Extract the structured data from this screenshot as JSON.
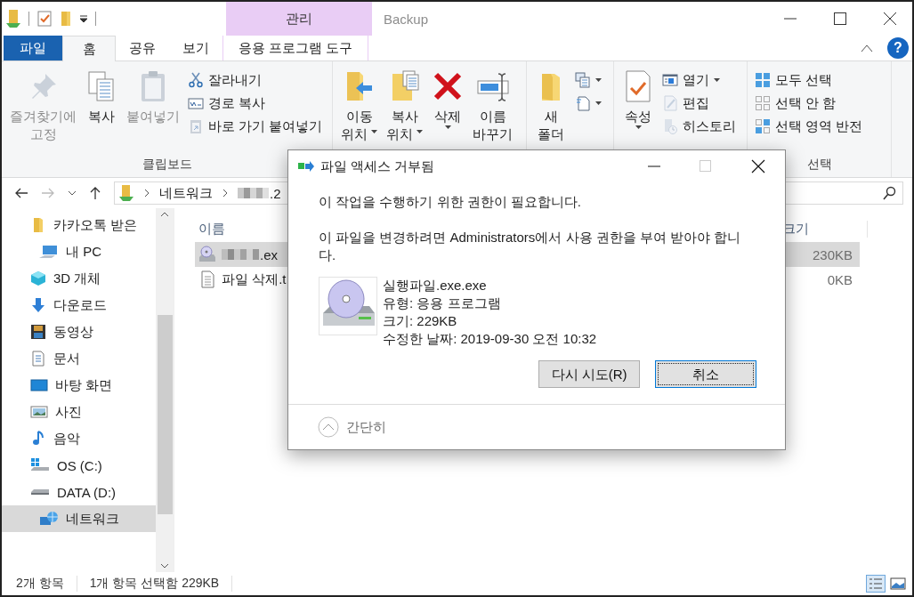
{
  "window": {
    "title": "Backup",
    "context_group": "관리"
  },
  "tabs": [
    {
      "label": "파일",
      "kind": "file",
      "selected": false
    },
    {
      "label": "홈",
      "kind": "plain",
      "selected": true
    },
    {
      "label": "공유",
      "kind": "plain",
      "selected": false
    },
    {
      "label": "보기",
      "kind": "plain",
      "selected": false
    },
    {
      "label": "응용 프로그램 도구",
      "kind": "context",
      "selected": false
    }
  ],
  "help_label": "?",
  "ribbon": {
    "groups": [
      {
        "label": "클립보드",
        "large": [
          {
            "kind": "pin",
            "lines": [
              "즐겨찾기에",
              "고정"
            ],
            "disabled": true,
            "dropdown": false
          },
          {
            "kind": "copy",
            "lines": [
              "복사"
            ],
            "disabled": false,
            "dropdown": false
          },
          {
            "kind": "paste",
            "lines": [
              "붙여넣기"
            ],
            "disabled": true,
            "dropdown": false
          }
        ],
        "small": [
          {
            "kind": "cut",
            "label": "잘라내기",
            "disabled": false,
            "dropdown": false
          },
          {
            "kind": "copy-path",
            "label": "경로 복사",
            "disabled": false,
            "dropdown": false
          },
          {
            "kind": "paste-shortcut",
            "label": "바로 가기 붙여넣기",
            "disabled": true,
            "dropdown": false
          }
        ]
      },
      {
        "large": [
          {
            "kind": "move-to",
            "lines": [
              "이동",
              "위치"
            ],
            "disabled": false,
            "dropdown": true
          },
          {
            "kind": "copy-to",
            "lines": [
              "복사",
              "위치"
            ],
            "disabled": false,
            "dropdown": true
          },
          {
            "kind": "delete",
            "lines": [
              "삭제"
            ],
            "disabled": false,
            "dropdown": true
          },
          {
            "kind": "rename",
            "lines": [
              "이름",
              "바꾸기"
            ],
            "disabled": false,
            "dropdown": false
          }
        ]
      },
      {
        "large": [
          {
            "kind": "new-folder",
            "lines": [
              "새",
              "폴더"
            ],
            "disabled": false,
            "dropdown": false
          }
        ],
        "small": [
          {
            "kind": "new-item",
            "disabled": false,
            "dropdown": true
          },
          {
            "kind": "easy-access",
            "disabled": false,
            "dropdown": true
          }
        ]
      },
      {
        "large": [
          {
            "kind": "properties",
            "lines": [
              "속성"
            ],
            "disabled": false,
            "dropdown": true
          }
        ],
        "small": [
          {
            "kind": "open",
            "label": "열기",
            "disabled": false,
            "dropdown": true
          },
          {
            "kind": "edit",
            "label": "편집",
            "disabled": true,
            "dropdown": false
          },
          {
            "kind": "history",
            "label": "히스토리",
            "disabled": true,
            "dropdown": false
          }
        ]
      },
      {
        "label": "선택",
        "small": [
          {
            "kind": "select-all",
            "label": "모두 선택",
            "disabled": false,
            "dropdown": false
          },
          {
            "kind": "select-none",
            "label": "선택 안 함",
            "disabled": false,
            "dropdown": false
          },
          {
            "kind": "invert-selection",
            "label": "선택 영역 반전",
            "disabled": false,
            "dropdown": false
          }
        ]
      }
    ]
  },
  "address": {
    "back_enabled": true,
    "forward_enabled": false,
    "crumbs": [
      {
        "label": "네트워크",
        "redacted": false
      },
      {
        "label": ".2",
        "redacted": true
      }
    ]
  },
  "nav": {
    "items": [
      {
        "children": [
          {
            "label": "카카오톡 받은",
            "kind": "folder",
            "selected": false
          }
        ]
      },
      {
        "label": "내 PC",
        "kind": "pc",
        "selected": false,
        "children": [
          {
            "label": "3D 개체",
            "kind": "cube",
            "selected": false
          },
          {
            "label": "다운로드",
            "kind": "download",
            "selected": false
          },
          {
            "label": "동영상",
            "kind": "video",
            "selected": false
          },
          {
            "label": "문서",
            "kind": "document",
            "selected": false
          },
          {
            "label": "바탕 화면",
            "kind": "desktop",
            "selected": false
          },
          {
            "label": "사진",
            "kind": "picture",
            "selected": false
          },
          {
            "label": "음악",
            "kind": "music",
            "selected": false
          },
          {
            "label": "OS (C:)",
            "kind": "os-drive",
            "selected": false
          },
          {
            "label": "DATA (D:)",
            "kind": "drive",
            "selected": false
          }
        ]
      },
      {
        "label": "네트워크",
        "kind": "network",
        "selected": true
      }
    ]
  },
  "files": {
    "columns": [
      "이름",
      "크기"
    ],
    "rows": [
      {
        "name": ".ex",
        "size": "230KB",
        "kind": "program",
        "redacted": true,
        "selected": true
      },
      {
        "name": "파일 삭제.t",
        "size": "0KB",
        "kind": "text",
        "redacted": false,
        "selected": false
      }
    ]
  },
  "status_bar": {
    "items": [
      "2개 항목",
      "1개 항목 선택함 229KB"
    ],
    "views": [
      {
        "kind": "details",
        "selected": true
      },
      {
        "kind": "large-icons",
        "selected": false
      }
    ]
  },
  "dialog": {
    "title": "파일 액세스 거부됨",
    "maximize_enabled": false,
    "message": "이 작업을 수행하기 위한 권한이 필요합니다.",
    "detail": "이 파일을 변경하려면 Administrators에서 사용 권한을 부여 받아야 합니다.",
    "file": {
      "name": "실행파일.exe.exe",
      "lines": [
        "유형: 응용 프로그램",
        "크기: 229KB",
        "수정한 날짜: 2019-09-30 오전 10:32"
      ]
    },
    "buttons": [
      {
        "label": "다시 시도(R)",
        "focused": false
      },
      {
        "label": "취소",
        "focused": true
      }
    ],
    "toggle": "간단히"
  }
}
